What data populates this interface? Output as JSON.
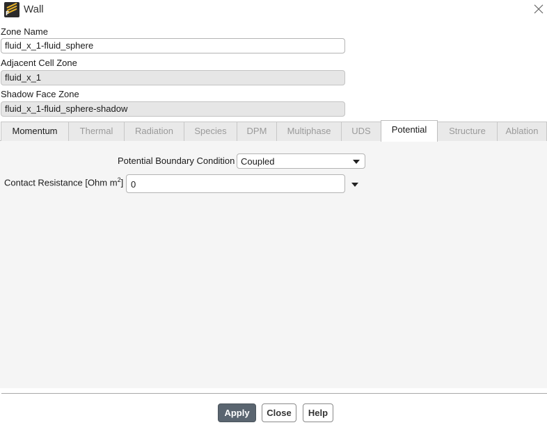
{
  "window": {
    "title": "Wall",
    "icon_letter": "F"
  },
  "zone_name": {
    "label": "Zone Name",
    "value": "fluid_x_1-fluid_sphere"
  },
  "adjacent_cell_zone": {
    "label": "Adjacent Cell Zone",
    "value": "fluid_x_1"
  },
  "shadow_face_zone": {
    "label": "Shadow Face Zone",
    "value": "fluid_x_1-fluid_sphere-shadow"
  },
  "tabs": [
    {
      "label": "Momentum"
    },
    {
      "label": "Thermal"
    },
    {
      "label": "Radiation"
    },
    {
      "label": "Species"
    },
    {
      "label": "DPM"
    },
    {
      "label": "Multiphase"
    },
    {
      "label": "UDS"
    },
    {
      "label": "Potential"
    },
    {
      "label": "Structure"
    },
    {
      "label": "Ablation"
    }
  ],
  "selected_tab": "Potential",
  "potential": {
    "bc_label": "Potential Boundary Condition",
    "bc_value": "Coupled",
    "contact_resistance_label": "Contact Resistance [Ohm m",
    "contact_resistance_unit_exp": "2",
    "contact_resistance_label_end": "]",
    "contact_resistance_value": "0"
  },
  "buttons": {
    "apply": "Apply",
    "close": "Close",
    "help": "Help"
  }
}
